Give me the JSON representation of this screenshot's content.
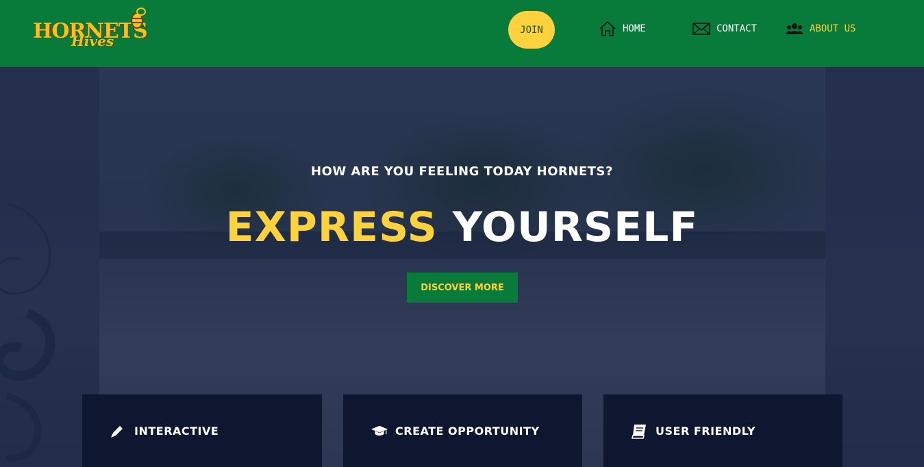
{
  "logo": {
    "line1": "HORNETS",
    "line2": "Hives"
  },
  "nav": {
    "join_label": "JOIN",
    "home_label": "HOME",
    "contact_label": "CONTACT",
    "about_label": "ABOUT US"
  },
  "hero": {
    "subtitle": "HOW ARE YOU FEELING TODAY HORNETS?",
    "title_highlight": "EXPRESS",
    "title_rest": "YOURSELF",
    "cta_label": "DISCOVER MORE"
  },
  "features": [
    {
      "icon": "pencil-icon",
      "title": "INTERACTIVE"
    },
    {
      "icon": "graduation-cap-icon",
      "title": "CREATE OPPORTUNITY"
    },
    {
      "icon": "book-icon",
      "title": "USER FRIENDLY"
    }
  ],
  "colors": {
    "nav_bg": "#087a3a",
    "accent_yellow": "#fdd23d",
    "card_bg": "#0f1730"
  }
}
